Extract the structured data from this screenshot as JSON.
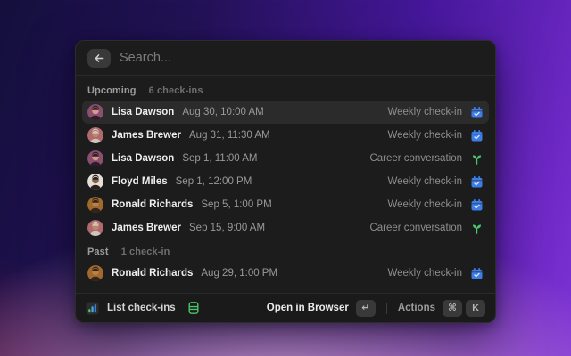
{
  "colors": {
    "accent_blue": "#3d7de8",
    "accent_green": "#4cc46a",
    "selected_row_bg": "#2c2b2c",
    "window_bg": "#1d1c1d"
  },
  "search": {
    "placeholder": "Search...",
    "back_icon": "arrow-left-icon",
    "value": ""
  },
  "sections": [
    {
      "title": "Upcoming",
      "count_label": "6 check-ins",
      "rows": [
        {
          "name": "Lisa Dawson",
          "datetime": "Aug 30, 10:00 AM",
          "tag": "Weekly check-in",
          "tag_icon": "calendar-check-icon",
          "selected": true,
          "avatar": {
            "bg": "#8a5070",
            "hair": "#2e1c2a",
            "skin": "#d79a84"
          }
        },
        {
          "name": "James Brewer",
          "datetime": "Aug 31, 11:30 AM",
          "tag": "Weekly check-in",
          "tag_icon": "calendar-check-icon",
          "selected": false,
          "avatar": {
            "bg": "#b06a6e",
            "hair": "#cfc5bd",
            "skin": "#c08566"
          }
        },
        {
          "name": "Lisa Dawson",
          "datetime": "Sep 1, 11:00 AM",
          "tag": "Career conversation",
          "tag_icon": "sprout-icon",
          "selected": false,
          "avatar": {
            "bg": "#8a5070",
            "hair": "#2e1c2a",
            "skin": "#d79a84"
          }
        },
        {
          "name": "Floyd Miles",
          "datetime": "Sep 1, 12:00 PM",
          "tag": "Weekly check-in",
          "tag_icon": "calendar-check-icon",
          "selected": false,
          "avatar": {
            "bg": "#e4dfd7",
            "hair": "#272120",
            "skin": "#8d5f3f"
          }
        },
        {
          "name": "Ronald Richards",
          "datetime": "Sep 5, 1:00 PM",
          "tag": "Weekly check-in",
          "tag_icon": "calendar-check-icon",
          "selected": false,
          "avatar": {
            "bg": "#a06a2c",
            "hair": "#31241a",
            "skin": "#b97f4e"
          }
        },
        {
          "name": "James Brewer",
          "datetime": "Sep 15, 9:00 AM",
          "tag": "Career conversation",
          "tag_icon": "sprout-icon",
          "selected": false,
          "avatar": {
            "bg": "#b06a6e",
            "hair": "#cfc5bd",
            "skin": "#c08566"
          }
        }
      ]
    },
    {
      "title": "Past",
      "count_label": "1 check-in",
      "rows": [
        {
          "name": "Ronald Richards",
          "datetime": "Aug 29, 1:00 PM",
          "tag": "Weekly check-in",
          "tag_icon": "calendar-check-icon",
          "selected": false,
          "avatar": {
            "bg": "#a06a2c",
            "hair": "#31241a",
            "skin": "#b97f4e"
          }
        }
      ]
    }
  ],
  "footer": {
    "command_icon": "bar-chart-icon",
    "command_label": "List check-ins",
    "command_badge_icon": "book-icon",
    "primary_action_label": "Open in Browser",
    "primary_action_key": "↵",
    "secondary_action_label": "Actions",
    "secondary_action_keys": [
      "⌘",
      "K"
    ]
  }
}
